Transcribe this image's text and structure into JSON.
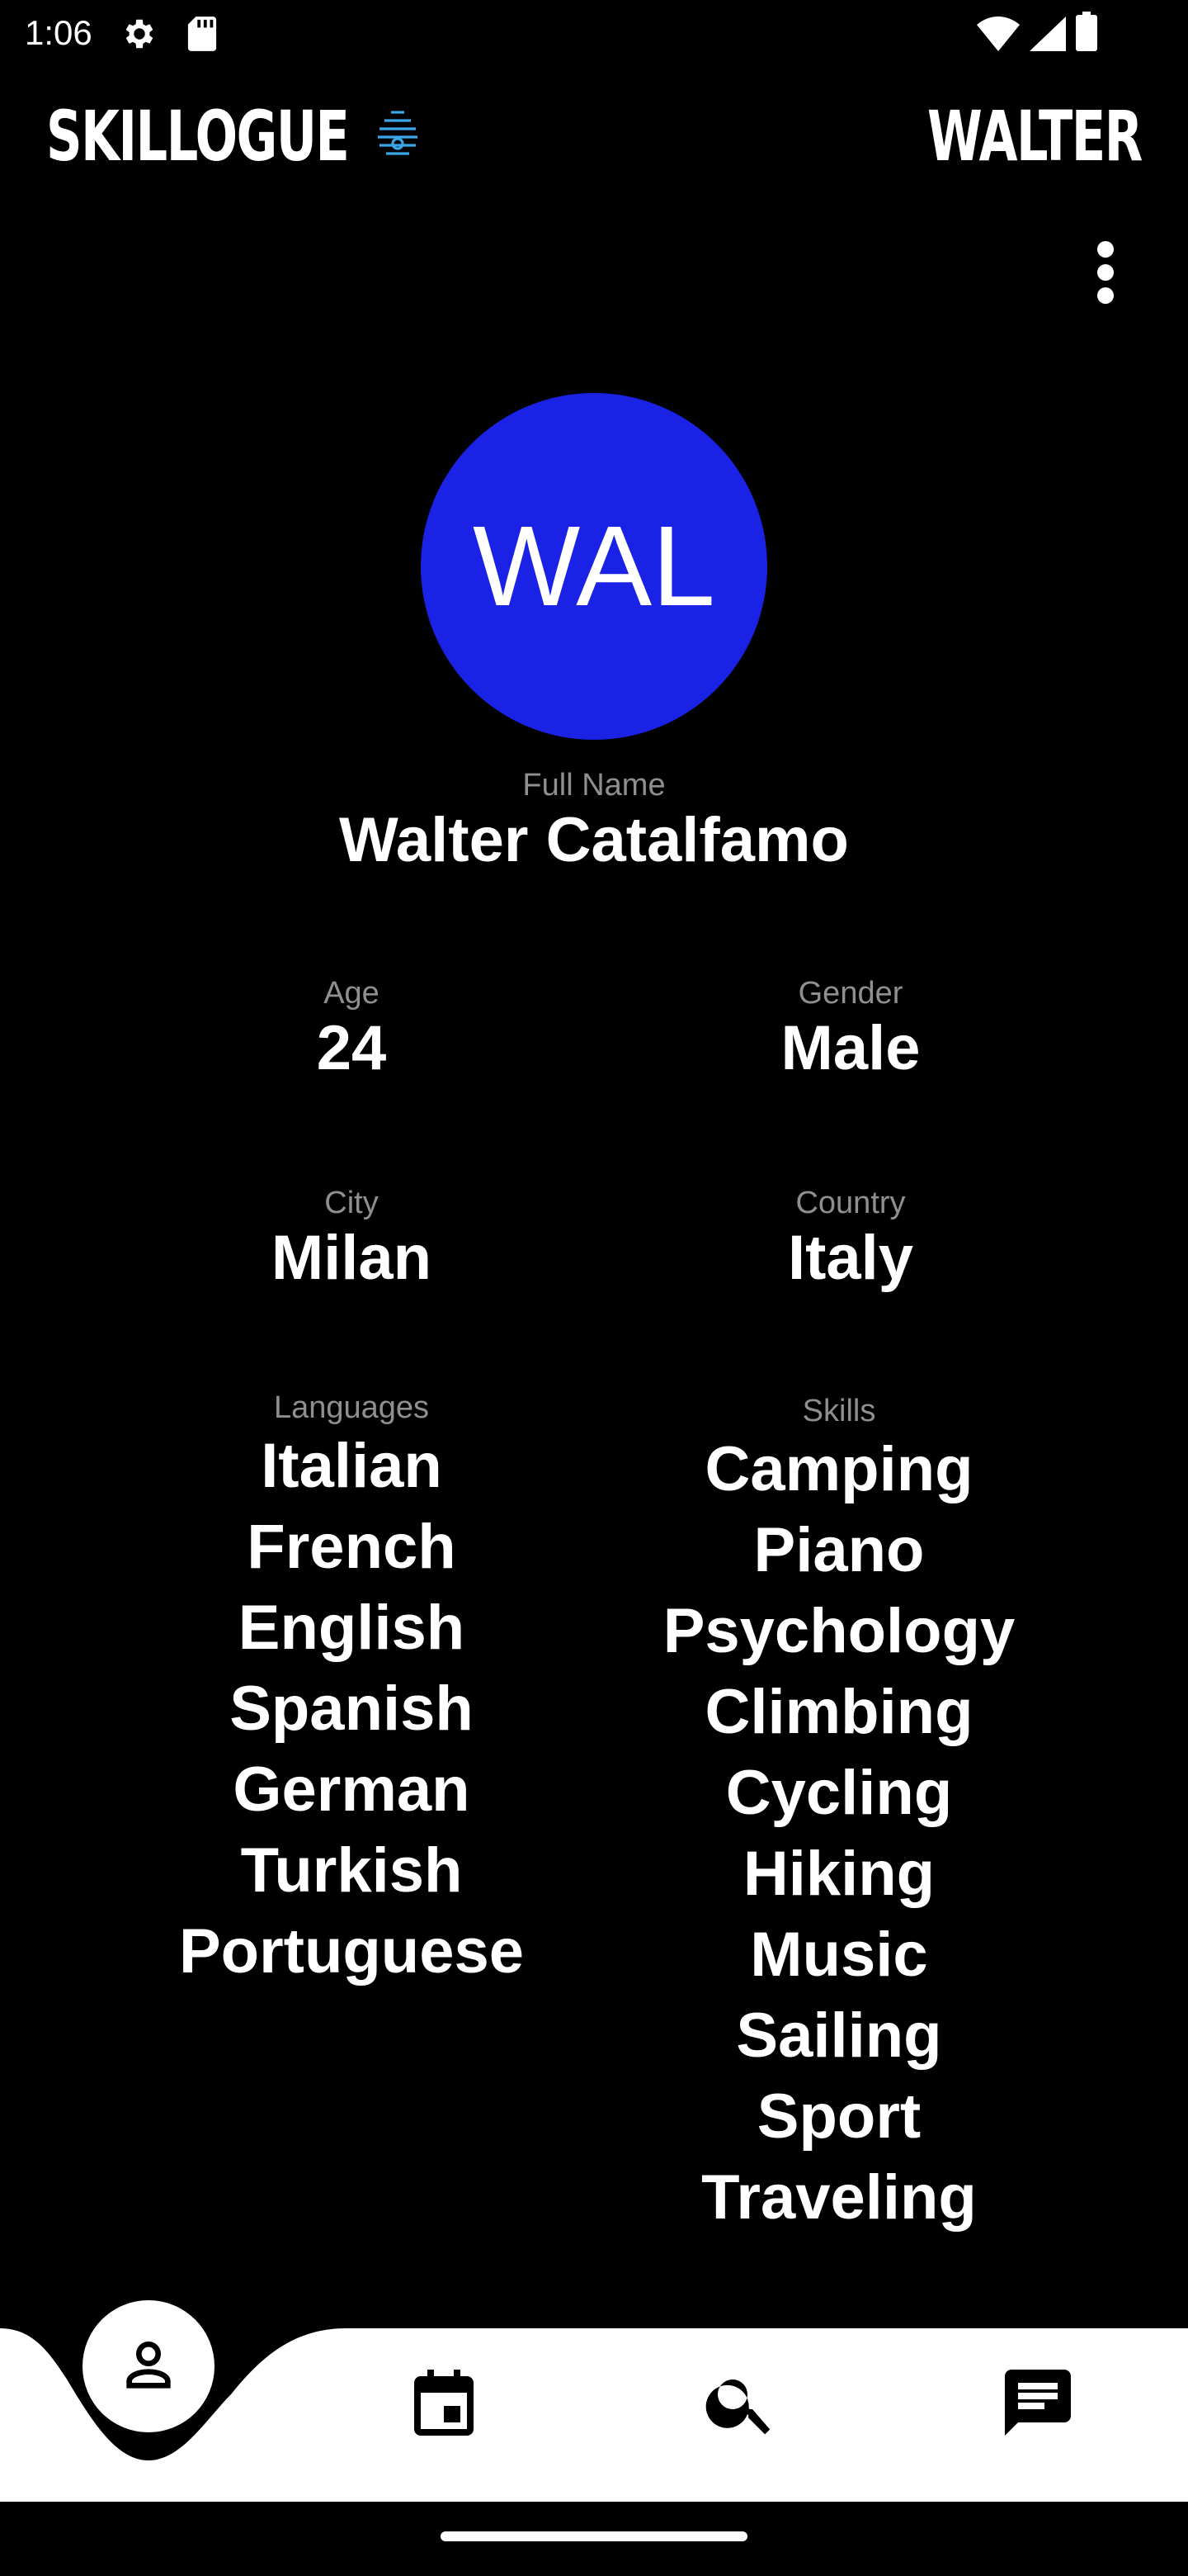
{
  "status_bar": {
    "time": "1:06",
    "icons": [
      "settings-icon",
      "sd-card-icon",
      "wifi-icon",
      "signal-icon",
      "battery-icon"
    ]
  },
  "header": {
    "app_title": "SKILLOGUE",
    "user_name": "WALTER",
    "logo_icon": "beehive-icon"
  },
  "profile": {
    "avatar_initials": "WAL",
    "avatar_color": "#1a22e6",
    "full_name_label": "Full Name",
    "full_name": "Walter Catalfamo",
    "age_label": "Age",
    "age": "24",
    "gender_label": "Gender",
    "gender": "Male",
    "city_label": "City",
    "city": "Milan",
    "country_label": "Country",
    "country": "Italy",
    "languages_label": "Languages",
    "languages": [
      "Italian",
      "French",
      "English",
      "Spanish",
      "German",
      "Turkish",
      "Portuguese"
    ],
    "skills_label": "Skills",
    "skills": [
      "Camping",
      "Piano",
      "Psychology",
      "Climbing",
      "Cycling",
      "Hiking",
      "Music",
      "Sailing",
      "Sport",
      "Traveling"
    ]
  },
  "bottom_nav": {
    "items": [
      "profile-icon",
      "calendar-icon",
      "search-icon",
      "chat-icon"
    ],
    "active": "profile-icon"
  }
}
